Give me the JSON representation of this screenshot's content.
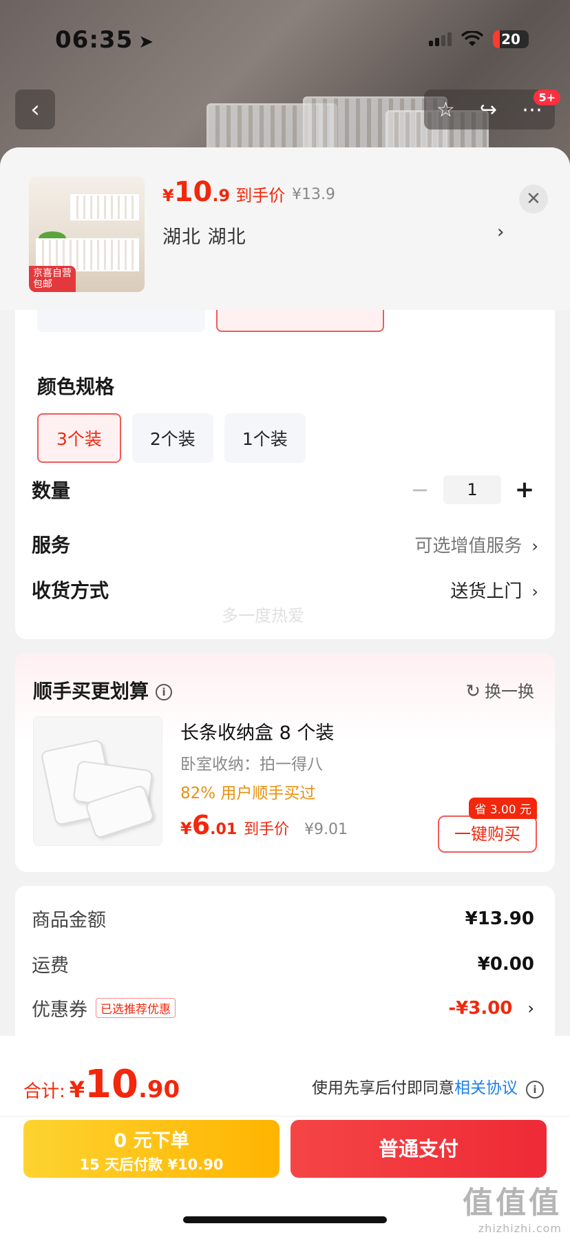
{
  "status": {
    "time": "06:35",
    "battery": "20"
  },
  "header": {
    "badge": "5+"
  },
  "product": {
    "price_yen": "¥",
    "price_int": "10",
    "price_dec": ".9",
    "price_label": "到手价",
    "orig_price": "¥13.9",
    "region": "湖北   湖北",
    "thumb_tag": "京喜自营\n包邮"
  },
  "spec": {
    "color_title": "颜色规格",
    "options": [
      "3个装",
      "2个装",
      "1个装"
    ],
    "selected_option": "3个装",
    "qty_label": "数量",
    "qty_value": "1",
    "service_label": "服务",
    "service_value": "可选增值服务",
    "delivery_label": "收货方式",
    "delivery_value": "送货上门",
    "watermark": "多一度热爱"
  },
  "recommend": {
    "title": "顺手买更划算",
    "refresh": "换一换",
    "name": "长条收纳盒 8 个装",
    "sub": "卧室收纳：拍一得八",
    "percent": "82% 用户顺手买过",
    "price_yen": "¥",
    "price_int": "6",
    "price_dec": ".01",
    "price_label": "到手价",
    "orig_price": "¥9.01",
    "save_tag": "省 3.00 元",
    "buy_label": "一键购买"
  },
  "summary": {
    "goods_label": "商品金额",
    "goods_value": "¥13.90",
    "ship_label": "运费",
    "ship_value": "¥0.00",
    "coupon_label": "优惠券",
    "coupon_tag": "已选推荐优惠",
    "coupon_value": "-¥3.00"
  },
  "bottom": {
    "total_label": "合计:",
    "total_yen": "¥",
    "total_int": "10",
    "total_dec": ".90",
    "agree_text": "使用先享后付即同意",
    "agree_link": "相关协议",
    "pay_later_l1": "0 元下单",
    "pay_later_l2": "15 天后付款 ¥10.90",
    "pay_now": "普通支付"
  },
  "site_logo": {
    "big": "值值值",
    "small": "zhizhizhi.com"
  },
  "colors": {
    "accent_red": "#f2270c",
    "pay_yellow": "#ffb400",
    "link_blue": "#1d7fe8"
  }
}
